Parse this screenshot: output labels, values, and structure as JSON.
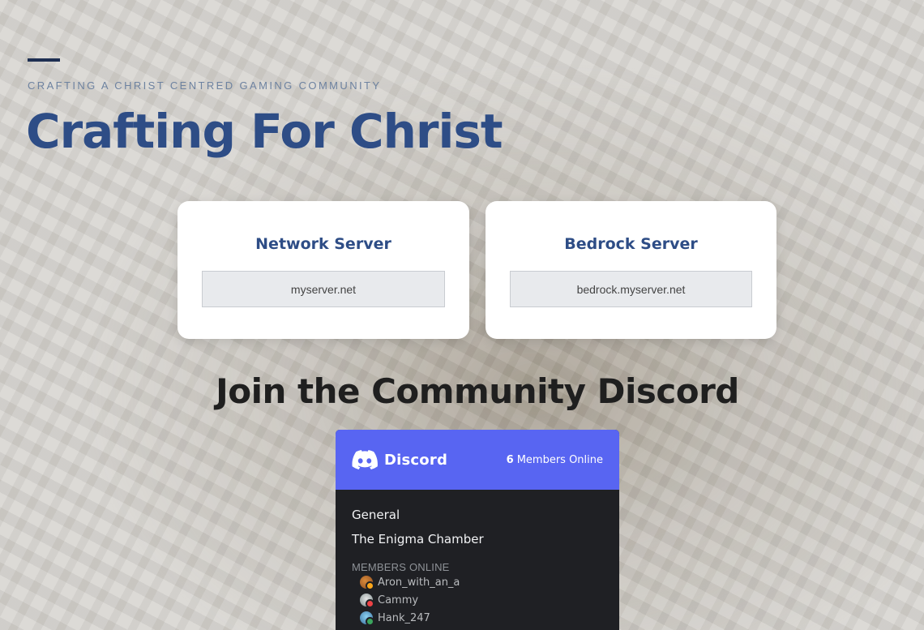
{
  "hero": {
    "tagline": "Crafting a Christ Centred Gaming Community",
    "title": "Crafting For Christ"
  },
  "servers": [
    {
      "title": "Network Server",
      "address": "myserver.net"
    },
    {
      "title": "Bedrock Server",
      "address": "bedrock.myserver.net"
    }
  ],
  "discord": {
    "heading": "Join the Community Discord",
    "brand": "Discord",
    "online_count": "6",
    "online_label": "Members Online",
    "channels": [
      "General",
      "The Enigma Chamber"
    ],
    "members_heading": "MEMBERS ONLINE",
    "members": [
      "Aron_with_an_a",
      "Cammy",
      "Hank_247"
    ],
    "colors": {
      "blurple": "#5865f2",
      "body": "#1f2024"
    }
  },
  "colors": {
    "accent": "#2e4d86",
    "accent_dark": "#1e2f52",
    "tagline": "#6d82a0"
  }
}
